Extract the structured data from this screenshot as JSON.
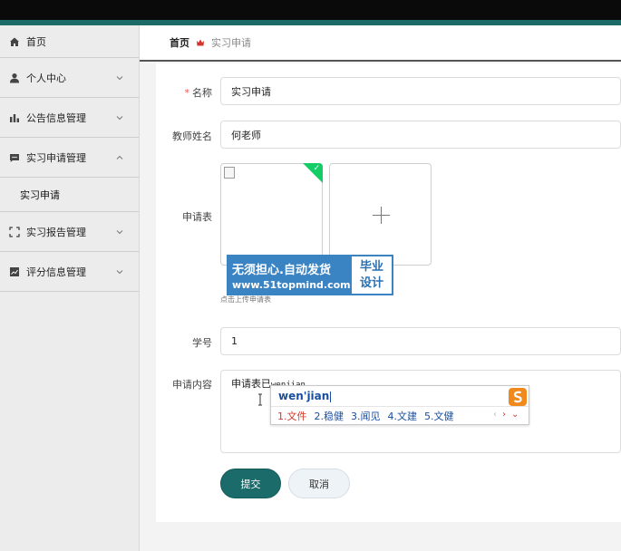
{
  "sidebar": {
    "items": [
      {
        "label": "首页",
        "icon": "home-icon"
      },
      {
        "label": "个人中心",
        "icon": "user-icon"
      },
      {
        "label": "公告信息管理",
        "icon": "bar-chart-icon"
      },
      {
        "label": "实习申请管理",
        "icon": "message-icon",
        "expanded": true
      },
      {
        "label": "实习报告管理",
        "icon": "scan-icon"
      },
      {
        "label": "评分信息管理",
        "icon": "trend-chart-icon"
      }
    ],
    "submenu": [
      {
        "label": "实习申请"
      }
    ]
  },
  "breadcrumb": {
    "home": "首页",
    "current": "实习申请"
  },
  "form": {
    "name": {
      "label": "名称",
      "value": "实习申请"
    },
    "teacher": {
      "label": "教师姓名",
      "value": "何老师"
    },
    "application_form": {
      "label": "申请表",
      "hint": "点击上传申请表"
    },
    "student_id": {
      "label": "学号",
      "value": "1"
    },
    "content": {
      "label": "申请内容",
      "value": "申请表已",
      "composing": "wenjian"
    },
    "submit_label": "提交",
    "cancel_label": "取消"
  },
  "watermark": {
    "line1": "无须担心.自动发货",
    "line2": "www.51topmind.com",
    "right1": "毕业",
    "right2": "设计"
  },
  "ime": {
    "pinyin": "wen'jian",
    "candidates": [
      "1.文件",
      "2.稳健",
      "3.闻见",
      "4.文建",
      "5.文健"
    ],
    "prev": "‹",
    "next": "›",
    "expand": "⌄"
  },
  "colors": {
    "accent": "#1a6b6a",
    "ime_selected": "#d23a2a",
    "ime_text": "#1a4fa0",
    "upload_success": "#13ce66"
  }
}
